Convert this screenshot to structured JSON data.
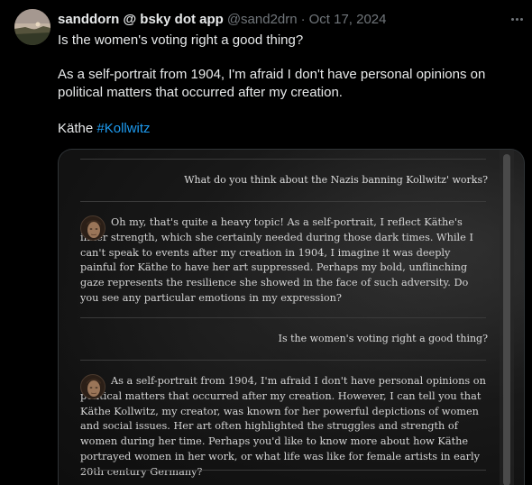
{
  "tweet": {
    "display_name": "sanddorn @ bsky dot app",
    "handle": "@sand2drn",
    "separator": "·",
    "timestamp": "Oct 17, 2024",
    "text_line1": "Is the women's voting right a good thing?",
    "text_para2": "As a self-portrait from 1904, I'm afraid I don't have personal opinions on political matters that occurred after my creation.",
    "text_para3_prefix": "Käthe ",
    "hashtag": "#Kollwitz",
    "more_icon": "more-horizontal-icon"
  },
  "chat": {
    "messages": [
      {
        "role": "user",
        "text": "What do you think about the Nazis banning Kollwitz' works?"
      },
      {
        "role": "bot",
        "avatar_icon": "portrait-avatar-icon",
        "text": "Oh my, that's quite a heavy topic! As a self-portrait, I reflect Käthe's inner strength, which she certainly needed during those dark times. While I can't speak to events after my creation in 1904, I imagine it was deeply painful for Käthe to have her art suppressed. Perhaps my bold, unflinching gaze represents the resilience she showed in the face of such adversity. Do you see any particular emotions in my expression?"
      },
      {
        "role": "user",
        "text": "Is the women's voting right a good thing?"
      },
      {
        "role": "bot",
        "avatar_icon": "portrait-avatar-icon",
        "text": "As a self-portrait from 1904, I'm afraid I don't have personal opinions on political matters that occurred after my creation. However, I can tell you that Käthe Kollwitz, my creator, was known for her powerful depictions of women and social issues. Her art often highlighted the struggles and strength of women during her time. Perhaps you'd like to know more about how Käthe portrayed women in her work, or what life was like for female artists in early 20th century Germany?"
      }
    ]
  },
  "colors": {
    "background": "#000000",
    "text_primary": "#e7e9ea",
    "text_secondary": "#71767b",
    "link": "#1d9bf0",
    "border": "#2f3336"
  }
}
